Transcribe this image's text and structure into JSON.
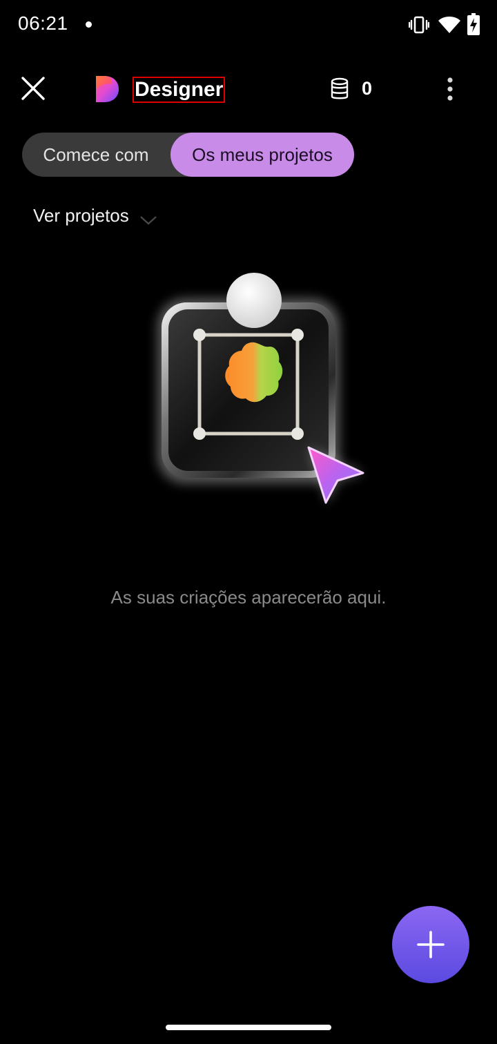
{
  "status_bar": {
    "time": "06:21",
    "icons": [
      "notification-dot-icon",
      "vibrate-icon",
      "wifi-icon",
      "battery-charging-icon"
    ]
  },
  "header": {
    "close_icon": "close-icon",
    "logo_icon": "designer-logo-icon",
    "title": "Designer",
    "credits_icon": "coins-stack-icon",
    "credits_count": "0",
    "more_icon": "more-vertical-icon"
  },
  "tabs": [
    {
      "label": "Comece com",
      "selected": false
    },
    {
      "label": "Os meus projetos",
      "selected": true
    }
  ],
  "filter": {
    "label": "Ver projetos",
    "icon": "chevron-down-icon"
  },
  "empty_state": {
    "illustration": "design-canvas-illustration",
    "message": "As suas criações aparecerão aqui."
  },
  "fab": {
    "icon": "plus-icon"
  },
  "colors": {
    "background": "#000000",
    "selected_tab": "#c88be8",
    "unselected_tab": "#3a3a3a",
    "fab_top": "#8b67f2",
    "fab_bottom": "#5b4ae0",
    "muted_text": "#8a8a8a"
  }
}
